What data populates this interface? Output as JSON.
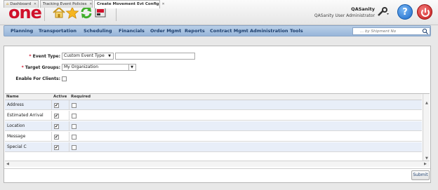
{
  "header": {
    "logo": "one",
    "user_name": "QASanity",
    "user_role": "QASanity User Administrator"
  },
  "nav": {
    "items": [
      "Planning",
      "Transportation",
      "Scheduling",
      "Financials",
      "Order Mgmt",
      "Reports",
      "Contract Mgmt",
      "Administration",
      "Tools"
    ],
    "search_placeholder": "... by Shipment No"
  },
  "tabs": [
    {
      "label": "Dashboard"
    },
    {
      "label": "Tracking Event Policies"
    },
    {
      "label": "Create Movement Evt Config"
    }
  ],
  "form": {
    "event_type_label": "Event Type:",
    "event_type_value": "Custom Event Type",
    "event_type_text": "",
    "target_groups_label": "Target Groups:",
    "target_groups_value": "My Organization",
    "enable_clients_label": "Enable For Clients:"
  },
  "grid": {
    "columns": [
      "Name",
      "Active",
      "Required"
    ],
    "rows": [
      {
        "name": "Address",
        "active": true,
        "required": false
      },
      {
        "name": "Estimated Arrival",
        "active": true,
        "required": false
      },
      {
        "name": "Location",
        "active": true,
        "required": false
      },
      {
        "name": "Message",
        "active": true,
        "required": false
      },
      {
        "name": "Special C",
        "active": true,
        "required": false
      }
    ]
  },
  "actions": {
    "submit_label": "Submit"
  },
  "colors": {
    "brand_red": "#d0112b",
    "nav_blue": "#98b6da",
    "row_alt": "#e8eef8"
  }
}
